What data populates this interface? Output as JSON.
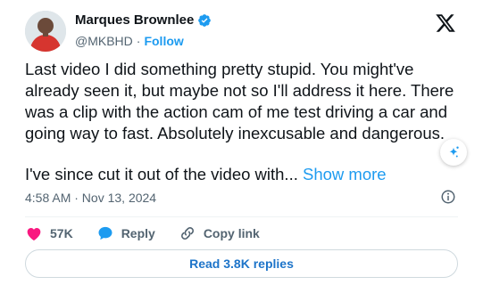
{
  "author": {
    "name": "Marques Brownlee",
    "handle": "@MKBHD",
    "separator": "·",
    "follow_label": "Follow"
  },
  "tweet": {
    "paragraph1": "Last video I did something pretty stupid. You might've already seen it, but maybe not so I'll address it here. There was a clip with the action cam of me test driving a car and going way to fast. Absolutely inexcusable and dangerous.",
    "paragraph2": "I've since cut it out of the video with...",
    "show_more": "Show more",
    "timestamp": "4:58 AM · Nov 13, 2024"
  },
  "actions": {
    "likes": "57K",
    "reply_label": "Reply",
    "copy_link_label": "Copy link"
  },
  "replies_button": "Read 3.8K replies",
  "colors": {
    "accent": "#1d9bf0",
    "like": "#f91880",
    "text": "#0f1419",
    "muted": "#536471"
  }
}
